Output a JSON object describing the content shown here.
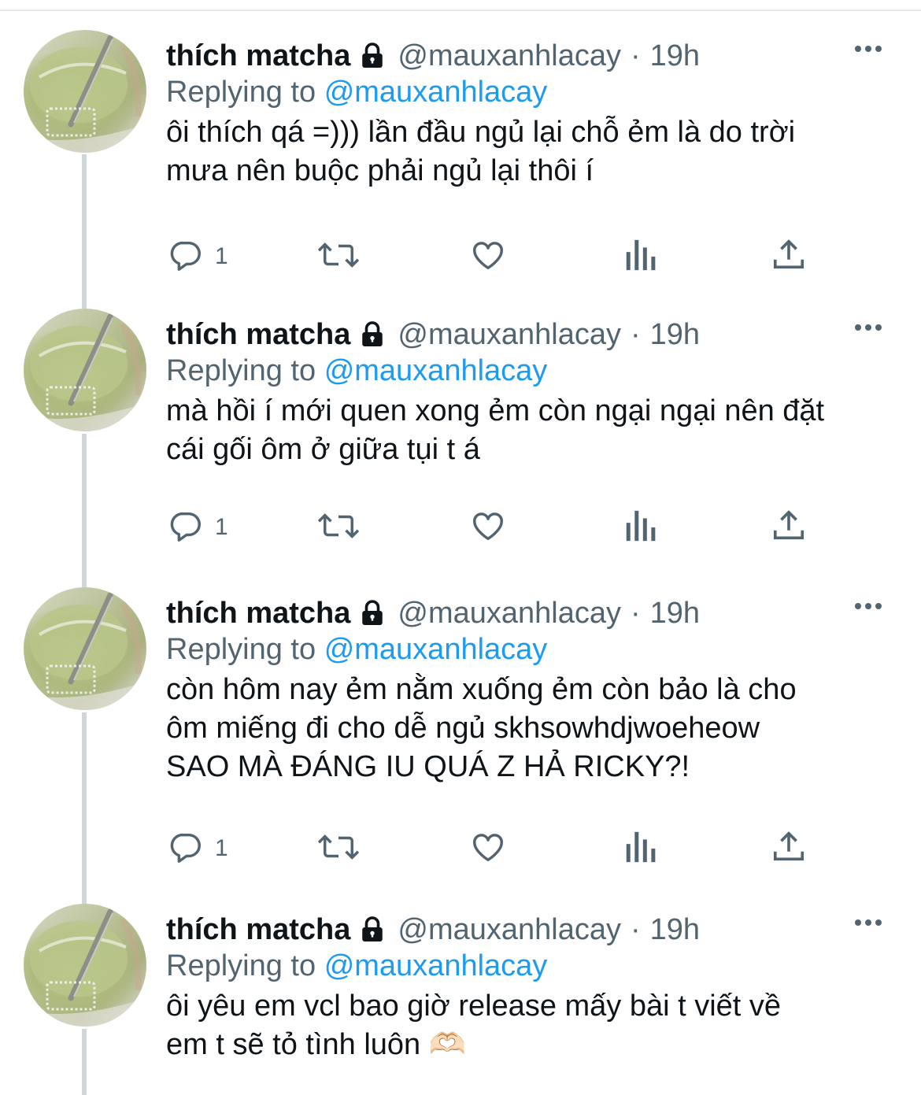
{
  "colors": {
    "text_primary": "#0f1419",
    "text_secondary": "#536471",
    "mention": "#1d9bf0",
    "thread_line": "#cfd6dc"
  },
  "tweets": [
    {
      "name": "thích matcha",
      "handle": "@mauxanhlacay",
      "dot": "·",
      "time": "19h",
      "replying_prefix": "Replying to",
      "replying_to": "@mauxanhlacay",
      "text": "ôi thích qá =))) lần đầu ngủ lại chỗ ẻm là do trời\nmưa nên buộc phải ngủ lại thôi í",
      "reply_count": "1",
      "icons": [
        "lock-icon",
        "more-icon",
        "reply-icon",
        "retweet-icon",
        "like-icon",
        "analytics-icon",
        "share-icon"
      ]
    },
    {
      "name": "thích matcha",
      "handle": "@mauxanhlacay",
      "dot": "·",
      "time": "19h",
      "replying_prefix": "Replying to",
      "replying_to": "@mauxanhlacay",
      "text": "mà hồi í mới quen xong ẻm còn ngại ngại nên đặt\ncái gối ôm ở giữa tụi t á",
      "reply_count": "1",
      "icons": [
        "lock-icon",
        "more-icon",
        "reply-icon",
        "retweet-icon",
        "like-icon",
        "analytics-icon",
        "share-icon"
      ]
    },
    {
      "name": "thích matcha",
      "handle": "@mauxanhlacay",
      "dot": "·",
      "time": "19h",
      "replying_prefix": "Replying to",
      "replying_to": "@mauxanhlacay",
      "text": "còn hôm nay ẻm nằm xuống ẻm còn bảo là cho\nôm miếng đi cho dễ ngủ skhsowhdjwoeheow\nSAO MÀ ĐÁNG IU QUÁ Z HẢ RICKY?!",
      "reply_count": "1",
      "icons": [
        "lock-icon",
        "more-icon",
        "reply-icon",
        "retweet-icon",
        "like-icon",
        "analytics-icon",
        "share-icon"
      ]
    },
    {
      "name": "thích matcha",
      "handle": "@mauxanhlacay",
      "dot": "·",
      "time": "19h",
      "replying_prefix": "Replying to",
      "replying_to": "@mauxanhlacay",
      "text": "ôi yêu em vcl bao giờ release mấy bài t viết về\nem t sẽ tỏ tình luôn 🫶🏻",
      "reply_count": "",
      "icons": [
        "lock-icon",
        "more-icon"
      ]
    }
  ]
}
